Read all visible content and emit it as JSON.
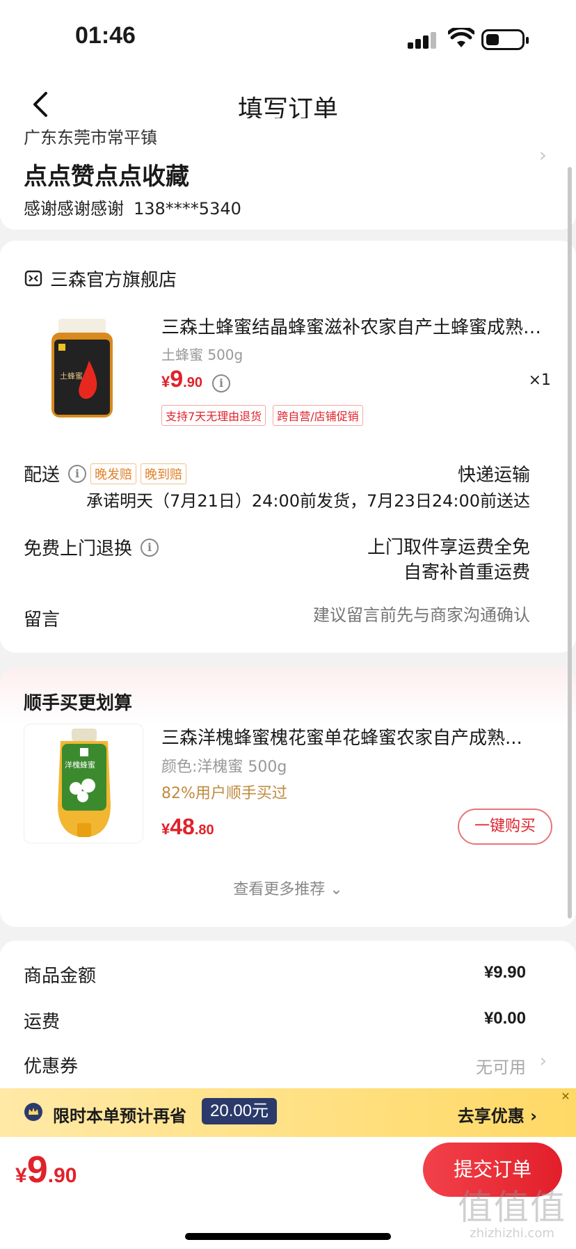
{
  "status_bar": {
    "time": "01:46"
  },
  "nav": {
    "title": "填写订单"
  },
  "address": {
    "region": "广东东莞市常平镇",
    "name": "点点赞点点收藏",
    "contact_name": "感谢感谢感谢",
    "phone": "138****5340"
  },
  "order": {
    "shop_name": "三森官方旗舰店",
    "product": {
      "title": "三森土蜂蜜结晶蜂蜜滋补农家自产土蜂蜜成熟原...",
      "spec": "土蜂蜜 500g",
      "price_symbol": "¥",
      "price_int": "9",
      "price_dec": ".90",
      "quantity": "×1",
      "tags": [
        "支持7天无理由退货",
        "跨自营/店铺促销"
      ]
    },
    "delivery": {
      "label": "配送",
      "tags": [
        "晚发赔",
        "晚到赔"
      ],
      "method": "快递运输",
      "promise": "承诺明天（7月21日）24:00前发货，7月23日24:00前送达"
    },
    "returns": {
      "label": "免费上门退换",
      "line1": "上门取件享运费全免",
      "line2": "自寄补首重运费"
    },
    "message": {
      "label": "留言",
      "placeholder": "建议留言前先与商家沟通确认"
    }
  },
  "recommend": {
    "title": "顺手买更划算",
    "item": {
      "name": "三森洋槐蜂蜜槐花蜜单花蜂蜜农家自产成熟...",
      "spec": "颜色:洋槐蜜 500g",
      "stat": "82%用户顺手买过",
      "price_symbol": "¥",
      "price_int": "48",
      "price_dec": ".80",
      "buy_label": "一键购买"
    },
    "more_label": "查看更多推荐 ⌄"
  },
  "summary": {
    "rows": [
      {
        "label": "商品金额",
        "value": "¥9.90"
      },
      {
        "label": "运费",
        "value": "¥0.00"
      },
      {
        "label": "优惠券",
        "value": "无可用"
      }
    ]
  },
  "promo": {
    "text": "限时本单预计再省",
    "amount": "20.00元",
    "cta": "去享优惠 ›"
  },
  "footer": {
    "price_symbol": "¥",
    "price_int": "9",
    "price_dec": ".90",
    "submit_label": "提交订单",
    "watermark_mark": "值值值",
    "watermark_url": "zhizhizhi.com"
  },
  "colors": {
    "accent": "#e0222b",
    "promo_bg": "#ffd966",
    "promo_pill": "#2b3a6b"
  },
  "icons": [
    "back-icon",
    "shop-icon",
    "info-icon",
    "chevron-right-icon",
    "crown-icon",
    "close-icon"
  ]
}
